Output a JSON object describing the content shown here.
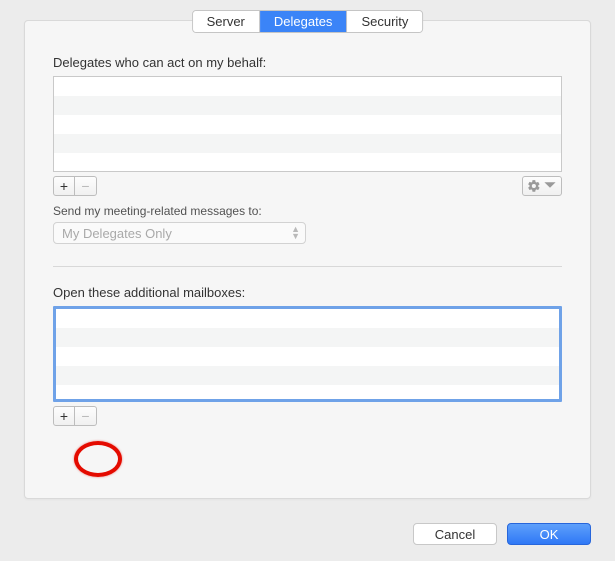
{
  "tabs": {
    "server": "Server",
    "delegates": "Delegates",
    "security": "Security"
  },
  "delegates_section": {
    "label": "Delegates who can act on my behalf:",
    "plus": "+",
    "minus": "−",
    "send_label": "Send my meeting-related messages to:",
    "send_select_value": "My Delegates Only"
  },
  "mailboxes_section": {
    "label": "Open these additional mailboxes:",
    "plus": "+",
    "minus": "−"
  },
  "footer": {
    "cancel": "Cancel",
    "ok": "OK"
  }
}
